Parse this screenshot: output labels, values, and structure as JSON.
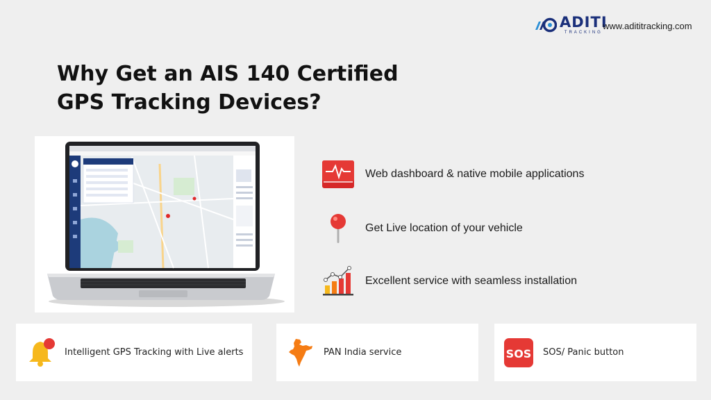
{
  "brand": {
    "name": "ADITI",
    "tagline": "TRACKING",
    "website": "www.adititracking.com",
    "color": "#1a2f7a"
  },
  "headline": {
    "line1": "Why Get an AIS 140 Certified",
    "line2": "GPS Tracking Devices?"
  },
  "features": [
    {
      "icon": "monitor-pulse-icon",
      "text": "Web dashboard & native mobile applications"
    },
    {
      "icon": "location-pin-icon",
      "text": "Get Live location of your vehicle"
    },
    {
      "icon": "bar-chart-icon",
      "text": "Excellent service with seamless installation"
    }
  ],
  "cards": [
    {
      "icon": "bell-alert-icon",
      "text": "Intelligent GPS Tracking with Live alerts"
    },
    {
      "icon": "india-map-icon",
      "text": "PAN India service"
    },
    {
      "icon": "sos-icon",
      "label": "SOS",
      "text": "SOS/ Panic button"
    }
  ],
  "colors": {
    "accent_red": "#e02828",
    "accent_orange": "#f57c14",
    "accent_yellow": "#f6b81c",
    "background": "#efefef"
  }
}
